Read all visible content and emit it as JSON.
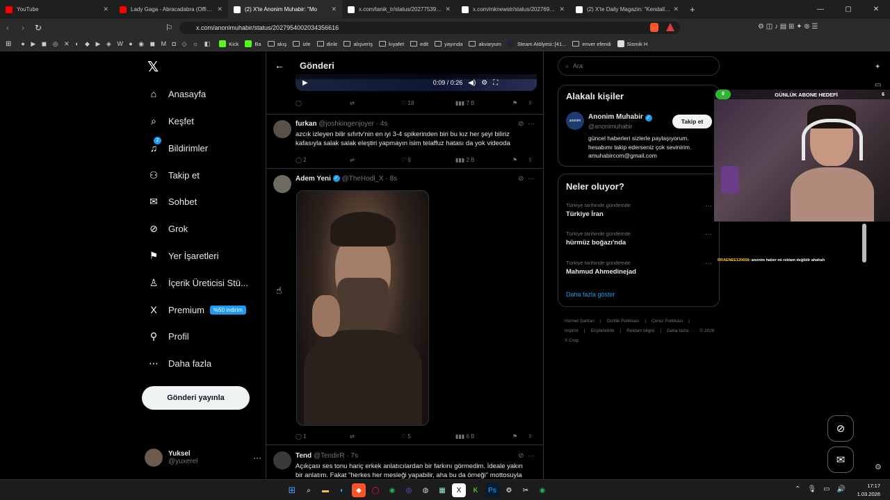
{
  "browser": {
    "tabs": [
      {
        "title": "YouTube",
        "color": "#ff0000",
        "active": false
      },
      {
        "title": "Lady Gaga - Abracadabra (Official Mu",
        "color": "#ff0000",
        "active": false
      },
      {
        "title": "(2) X'te Anonim Muhabir: \"Mo",
        "color": "#ffffff",
        "active": true
      },
      {
        "title": "x.com/tanik_tr/status/20277539897",
        "color": "#ffffff",
        "active": false
      },
      {
        "title": "x.com/mknewstr/status/202769023",
        "color": "#ffffff",
        "active": false
      },
      {
        "title": "(2) X'te Daily Magazin: \"Kendall Jenn",
        "color": "#ffffff",
        "active": false
      }
    ],
    "url": "x.com/anonimuhabir/status/2027954002034356616",
    "bookmarks": [
      {
        "label": "Kick",
        "type": "site",
        "color": "#53fc18"
      },
      {
        "label": "Ba",
        "type": "site",
        "color": "#53fc18"
      },
      {
        "label": "akış",
        "type": "folder"
      },
      {
        "label": "izle",
        "type": "folder"
      },
      {
        "label": "dinle",
        "type": "folder"
      },
      {
        "label": "alışveriş",
        "type": "folder"
      },
      {
        "label": "kıyafet",
        "type": "folder"
      },
      {
        "label": "edit",
        "type": "folder"
      },
      {
        "label": "yayında",
        "type": "folder"
      },
      {
        "label": "akvaryum",
        "type": "folder"
      },
      {
        "label": "Steam Atölyesi::[41...",
        "type": "site",
        "color": "#1b2838"
      },
      {
        "label": "enver efendi",
        "type": "folder"
      },
      {
        "label": "Sismik H",
        "type": "site",
        "color": "#dddddd"
      }
    ]
  },
  "sidebar": {
    "nav": [
      {
        "label": "Anasayfa",
        "icon": "home-icon",
        "glyph": "⌂"
      },
      {
        "label": "Keşfet",
        "icon": "search-icon",
        "glyph": "⌕"
      },
      {
        "label": "Bildirimler",
        "icon": "bell-icon",
        "glyph": "♫"
      },
      {
        "label": "Takip et",
        "icon": "follow-icon",
        "glyph": "⚇"
      },
      {
        "label": "Sohbet",
        "icon": "mail-icon",
        "glyph": "✉"
      },
      {
        "label": "Grok",
        "icon": "grok-icon",
        "glyph": "⊘"
      },
      {
        "label": "Yer İşaretleri",
        "icon": "bookmark-icon",
        "glyph": "⚑"
      },
      {
        "label": "İçerik Üreticisi Stü...",
        "icon": "creator-icon",
        "glyph": "♙"
      },
      {
        "label": "Premium",
        "icon": "x-premium-icon",
        "glyph": "X",
        "badge": "%50 indirim"
      },
      {
        "label": "Profil",
        "icon": "profile-icon",
        "glyph": "⚲"
      },
      {
        "label": "Daha fazla",
        "icon": "more-icon",
        "glyph": "⋯"
      }
    ],
    "notif_badge": "2",
    "post_button": "Gönderi yayınla",
    "user": {
      "name": "Yuksel",
      "handle": "@yuxerel"
    }
  },
  "main": {
    "header_title": "Gönderi",
    "video": {
      "time": "0:09 / 0:26"
    },
    "video_actions": {
      "replies": "",
      "reposts": "",
      "likes": "18",
      "views": "7 B"
    },
    "tweets": [
      {
        "name": "furkan",
        "handle": "@joshkingenjoyer",
        "time": "· 4s",
        "verified": false,
        "text": "azcık izleyen bilir sıfırtv'nin en iyi 3-4 spikerinden biri bu kız her şeyi biliriz kafasıyla salak salak eleştiri yapmayın isim telaffuz hatası da yok videoda",
        "replies": "2",
        "reposts": "",
        "likes": "9",
        "views": "2 B"
      },
      {
        "name": "Adem Yeni",
        "handle": "@TheHodl_X",
        "time": "· 8s",
        "verified": true,
        "text": "",
        "replies": "1",
        "reposts": "",
        "likes": "5",
        "views": "6 B"
      },
      {
        "name": "Tend",
        "handle": "@TendirR",
        "time": "· 7s",
        "verified": false,
        "text": "Açıkçası ses tonu hariç erkek anlatıcılardan bir farkını görmedim. İdeale yakın bir anlatım. Fakat \"herkes her mesleği yapabilir, aha bu da örneği\" mottosuyla",
        "replies": "",
        "reposts": "",
        "likes": "",
        "views": ""
      }
    ]
  },
  "right": {
    "search_placeholder": "Ara",
    "related_title": "Alakalı kişiler",
    "related": {
      "name": "Anonim Muhabir",
      "handle": "@anonimuhabir",
      "follow": "Takip et",
      "bio": "güncel haberleri sizlerle paylaşıyorum. hesabımı takip ederseniz çok sevinirim. amuhabircom@gmail.com"
    },
    "trends_title": "Neler oluyor?",
    "trends": [
      {
        "context": "Türkiye tarihinde gündemde",
        "title": "Türkiye İran"
      },
      {
        "context": "Türkiye tarihinde gündemde",
        "title": "hürmüz boğazı'nda"
      },
      {
        "context": "Türkiye tarihinde gündemde",
        "title": "Mahmud Ahmedinejad"
      }
    ],
    "show_more": "Daha fazla göster",
    "footer": [
      "Hizmet Şartları",
      "|",
      "Gizlilik Politikası",
      "|",
      "Çerez Politikası",
      "|",
      "Imprint",
      "|",
      "Erişilebilirlik",
      "|",
      "Reklam bilgisi",
      "|",
      "Daha fazla ···",
      "© 2026 X Corp."
    ]
  },
  "overlay": {
    "subgoal_start": "0",
    "subgoal_title": "GÜNLÜK ABONE HEDEFİ",
    "subgoal_end": "6",
    "chat_user": "RRAENEE120658",
    "chat_msg": ": anonim haber mi reklam değildir ahahah"
  },
  "taskbar": {
    "time": "17:17",
    "date": "1.03.2026"
  }
}
